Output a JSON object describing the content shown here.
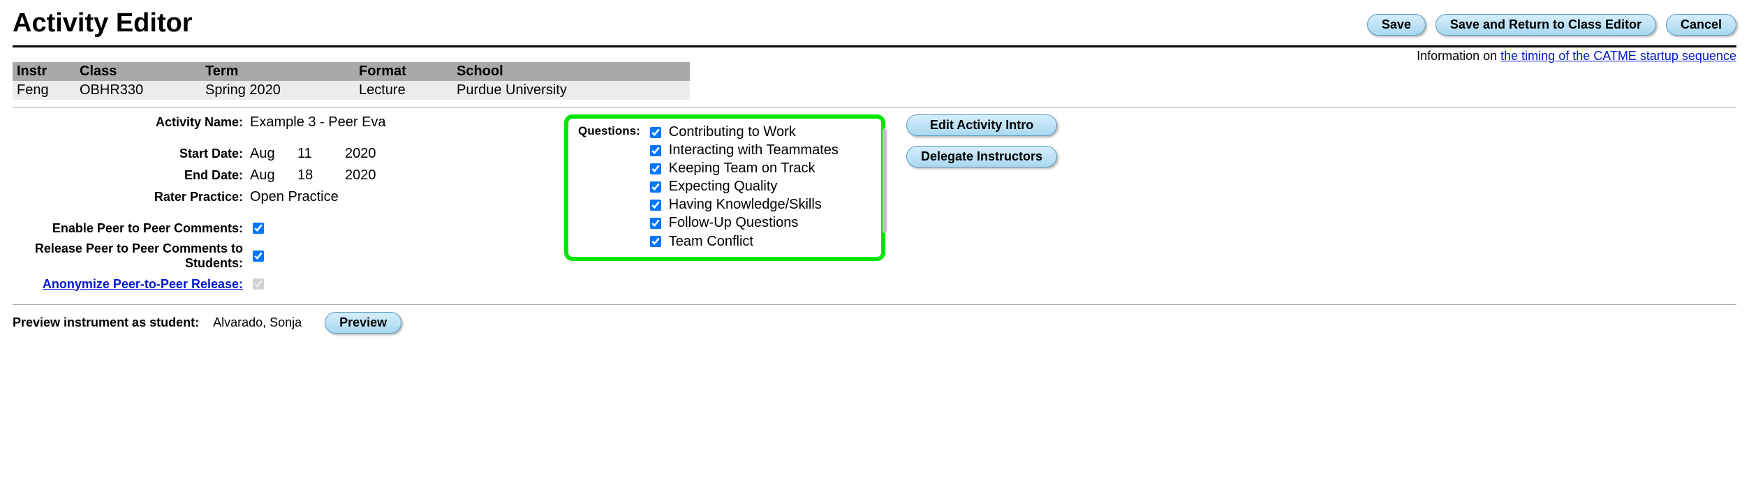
{
  "header": {
    "title": "Activity Editor",
    "buttons": {
      "save": "Save",
      "save_return": "Save and Return to Class Editor",
      "cancel": "Cancel"
    }
  },
  "info_line": {
    "prefix": "Information on ",
    "link_text": "the timing of the CATME startup sequence"
  },
  "class_table": {
    "headers": {
      "instr": "Instr",
      "class": "Class",
      "term": "Term",
      "format": "Format",
      "school": "School"
    },
    "row": {
      "instr": "Feng",
      "class": "OBHR330",
      "term": "Spring 2020",
      "format": "Lecture",
      "school": "Purdue University"
    }
  },
  "fields": {
    "activity_name_label": "Activity Name:",
    "activity_name_value": "Example 3 - Peer Eva",
    "start_date_label": "Start Date:",
    "start_date": {
      "month": "Aug",
      "day": "11",
      "year": "2020"
    },
    "end_date_label": "End Date:",
    "end_date": {
      "month": "Aug",
      "day": "18",
      "year": "2020"
    },
    "rater_practice_label": "Rater Practice:",
    "rater_practice_value": "Open Practice",
    "enable_p2p_label": "Enable Peer to Peer Comments:",
    "release_p2p_label": "Release Peer to Peer Comments to Students:",
    "anonymize_label": "Anonymize Peer-to-Peer Release:"
  },
  "questions": {
    "label": "Questions:",
    "items": [
      "Contributing to Work",
      "Interacting with Teammates",
      "Keeping Team on Track",
      "Expecting Quality",
      "Having Knowledge/Skills",
      "Follow-Up Questions",
      "Team Conflict"
    ]
  },
  "side_buttons": {
    "edit_intro": "Edit Activity Intro",
    "delegate": "Delegate Instructors"
  },
  "preview": {
    "label": "Preview instrument as student:",
    "student": "Alvarado, Sonja",
    "button": "Preview"
  }
}
